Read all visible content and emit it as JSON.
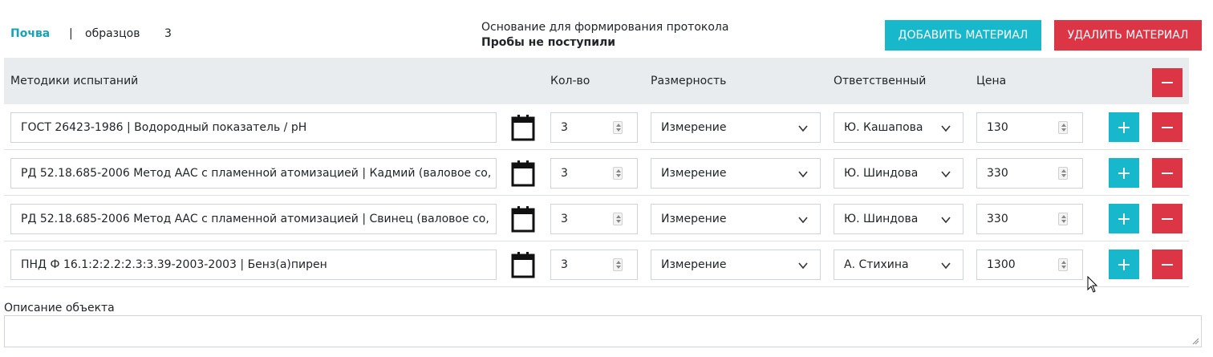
{
  "header": {
    "material_name": "Почва",
    "separator": "|",
    "samples_label": "образцов",
    "samples_count": "3",
    "basis_label": "Основание для формирования протокола",
    "basis_status": "Пробы не поступили",
    "add_material_label": "ДОБАВИТЬ МАТЕРИАЛ",
    "remove_material_label": "УДАЛИТЬ МАТЕРИАЛ"
  },
  "table": {
    "columns": {
      "methods": "Методики испытаний",
      "qty": "Кол-во",
      "unit": "Размерность",
      "responsible": "Ответственный",
      "price": "Цена"
    },
    "rows": [
      {
        "method": "ГОСТ 26423-1986 | Водородный показатель / pH",
        "qty": "3",
        "unit": "Измерение",
        "responsible": "Ю. Кашапова",
        "price": "130"
      },
      {
        "method": "РД 52.18.685-2006 Метод ААС с пламенной атомизацией | Кадмий (валовое со,",
        "qty": "3",
        "unit": "Измерение",
        "responsible": "Ю. Шиндова",
        "price": "330"
      },
      {
        "method": "РД 52.18.685-2006 Метод ААС с пламенной атомизацией | Свинец (валовое со,",
        "qty": "3",
        "unit": "Измерение",
        "responsible": "Ю. Шиндова",
        "price": "330"
      },
      {
        "method": "ПНД Ф 16.1:2:2.2:2.3:3.39-2003-2003 | Бенз(а)пирен",
        "qty": "3",
        "unit": "Измерение",
        "responsible": "А. Стихина",
        "price": "1300"
      }
    ]
  },
  "description": {
    "label": "Описание объекта",
    "value": ""
  },
  "colors": {
    "accent": "#17b8cc",
    "danger": "#dc3545",
    "header_bg": "#e9ecef"
  }
}
